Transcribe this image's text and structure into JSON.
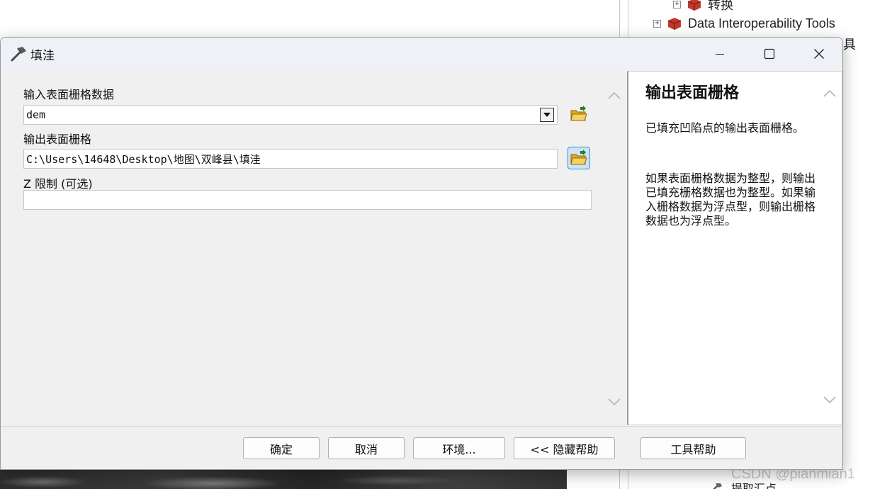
{
  "background": {
    "toolbox_items": [
      {
        "label": "转换"
      },
      {
        "label": "Data Interoperability Tools"
      },
      {
        "label": "具"
      }
    ],
    "below_item_label": "提取汇点",
    "watermark": "CSDN @pianmian1"
  },
  "dialog": {
    "title": "填洼",
    "params": {
      "input_raster": {
        "label": "输入表面栅格数据",
        "value": "dem"
      },
      "output_raster": {
        "label": "输出表面栅格",
        "value": "C:\\Users\\14648\\Desktop\\地图\\双峰县\\填洼"
      },
      "z_limit": {
        "label": "Z 限制 (可选)",
        "value": ""
      }
    },
    "help": {
      "title": "输出表面栅格",
      "paragraph_1": "已填充凹陷点的输出表面栅格。",
      "paragraph_2": "如果表面栅格数据为整型，则输出已填充栅格数据也为整型。如果输入栅格数据为浮点型，则输出栅格数据也为浮点型。"
    },
    "buttons": {
      "ok": "确定",
      "cancel": "取消",
      "environments": "环境...",
      "hide_help": "<< 隐藏帮助",
      "tool_help": "工具帮助"
    }
  },
  "colors": {
    "toolbox_red": "#c0392b",
    "folder_yellow": "#f2c230",
    "browse_highlight": "#cde4f7"
  }
}
